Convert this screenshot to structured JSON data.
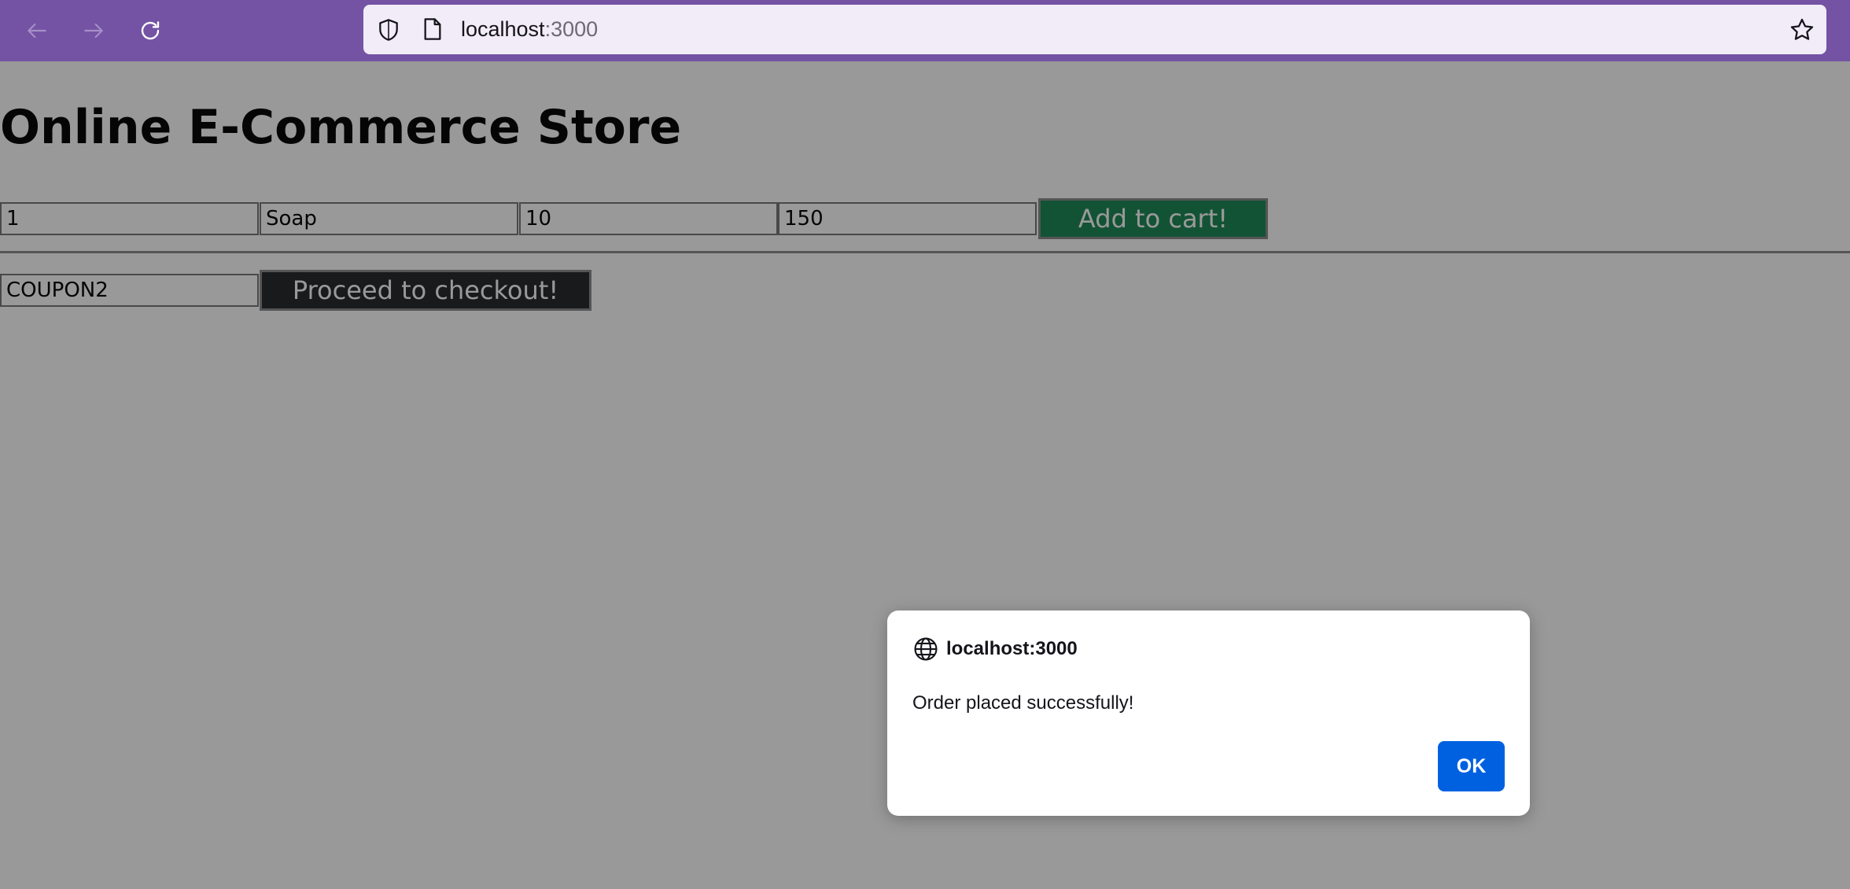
{
  "browser": {
    "back_icon": "arrow-left-icon",
    "forward_icon": "arrow-right-icon",
    "reload_icon": "reload-icon",
    "url_host": "localhost",
    "url_port": ":3000",
    "toolbar_color": "#7452a4"
  },
  "page": {
    "title": "Online E-Commerce Store",
    "product_form": {
      "id_value": "1",
      "name_value": "Soap",
      "quantity_value": "10",
      "price_value": "150",
      "add_button_label": "Add to cart!",
      "add_button_color": "#198754"
    },
    "checkout_form": {
      "coupon_value": "COUPON2",
      "checkout_button_label": "Proceed to checkout!",
      "checkout_button_color": "#212529"
    }
  },
  "alert_dialog": {
    "origin": "localhost:3000",
    "message": "Order placed successfully!",
    "ok_label": "OK",
    "ok_color": "#0061e0"
  }
}
